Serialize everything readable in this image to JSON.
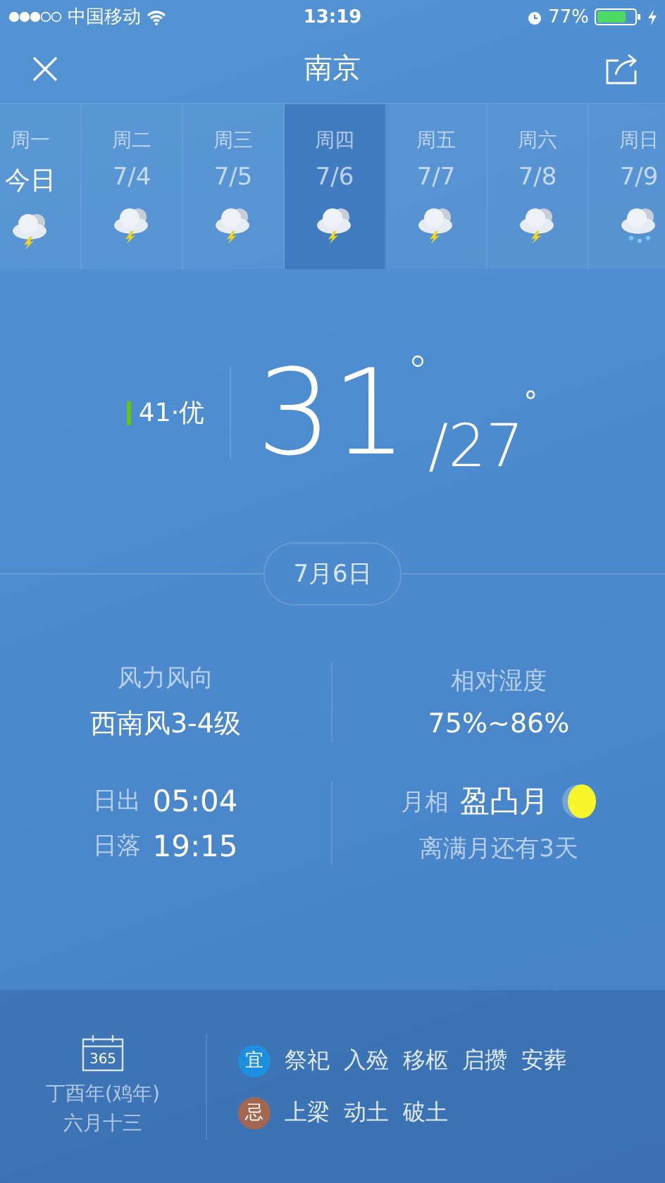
{
  "status_bar": {
    "carrier": "中国移动",
    "time": "13:19",
    "battery": "77%"
  },
  "header": {
    "title": "南京"
  },
  "days": [
    {
      "weekday": "周一",
      "date": "今日",
      "kind": "thunder",
      "selected": false,
      "today": true
    },
    {
      "weekday": "周二",
      "date": "7/4",
      "kind": "thunder",
      "selected": false,
      "today": false
    },
    {
      "weekday": "周三",
      "date": "7/5",
      "kind": "thunder",
      "selected": false,
      "today": false
    },
    {
      "weekday": "周四",
      "date": "7/6",
      "kind": "thunder",
      "selected": true,
      "today": false
    },
    {
      "weekday": "周五",
      "date": "7/7",
      "kind": "thunder",
      "selected": false,
      "today": false
    },
    {
      "weekday": "周六",
      "date": "7/8",
      "kind": "thunder",
      "selected": false,
      "today": false
    },
    {
      "weekday": "周日",
      "date": "7/9",
      "kind": "rain",
      "selected": false,
      "today": false
    }
  ],
  "aqi": {
    "text": "41·优",
    "color": "#66c21a"
  },
  "temperature": {
    "high": "31",
    "degree_high": "°",
    "slash": "/",
    "low": "27",
    "degree_low": "°"
  },
  "date_pill": "7月6日",
  "details": [
    {
      "kind": "stack",
      "label": "风力风向",
      "value": "西南风3-4级"
    },
    {
      "kind": "stack",
      "label": "相对湿度",
      "value": "75%~86%"
    },
    {
      "kind": "sun",
      "rows": [
        {
          "label": "日出",
          "value": "05:04"
        },
        {
          "label": "日落",
          "value": "19:15"
        }
      ]
    },
    {
      "kind": "moon",
      "label": "月相",
      "value": "盈凸月",
      "note": "离满月还有3天"
    }
  ],
  "almanac": {
    "icon_text": "365",
    "year": "丁酉年(鸡年)",
    "lunar_date": "六月十三",
    "rows": [
      {
        "tag": "宜",
        "color": "#1e8fde",
        "items": [
          "祭祀",
          "入殓",
          "移柩",
          "启攒",
          "安葬"
        ]
      },
      {
        "tag": "忌",
        "color": "#a3674f",
        "items": [
          "上梁",
          "动土",
          "破土"
        ]
      }
    ]
  }
}
